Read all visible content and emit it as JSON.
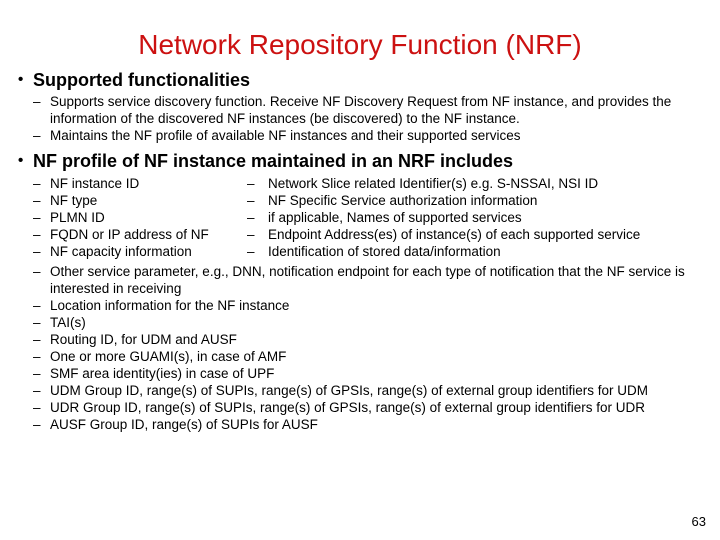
{
  "slide": {
    "title": "Network Repository Function (NRF)",
    "title_color": "#cc1111",
    "page_number": "63",
    "bullet_glyph": "•",
    "dash_glyph": "–"
  },
  "sections": [
    {
      "heading": "Supported functionalities",
      "items": [
        "Supports service discovery function. Receive NF Discovery Request from NF instance, and provides the information of the discovered NF instances (be discovered) to the NF instance.",
        "Maintains the NF profile of available NF instances and their supported services"
      ]
    },
    {
      "heading": "NF profile of NF instance maintained in an NRF includes",
      "column_left": [
        "NF instance ID",
        "NF type",
        "PLMN ID",
        "FQDN or IP address of NF",
        "NF capacity information"
      ],
      "column_right": [
        "Network Slice related Identifier(s) e.g. S-NSSAI, NSI ID",
        "NF Specific Service authorization information",
        "if applicable, Names of supported services",
        "Endpoint Address(es) of instance(s) of each supported service",
        "Identification of stored data/information"
      ],
      "items_rest": [
        "Other service parameter, e.g., DNN, notification endpoint for each type of notification that the NF service is interested in receiving",
        "Location information for the NF instance",
        "TAI(s)",
        "Routing ID, for UDM and AUSF",
        "One or more GUAMI(s), in case of AMF",
        "SMF area identity(ies) in case of UPF",
        "UDM Group ID, range(s) of SUPIs, range(s) of GPSIs, range(s) of external group identifiers for UDM",
        "UDR Group ID, range(s) of SUPIs, range(s) of GPSIs, range(s) of external group identifiers for UDR",
        "AUSF Group ID, range(s) of SUPIs for AUSF"
      ]
    }
  ]
}
